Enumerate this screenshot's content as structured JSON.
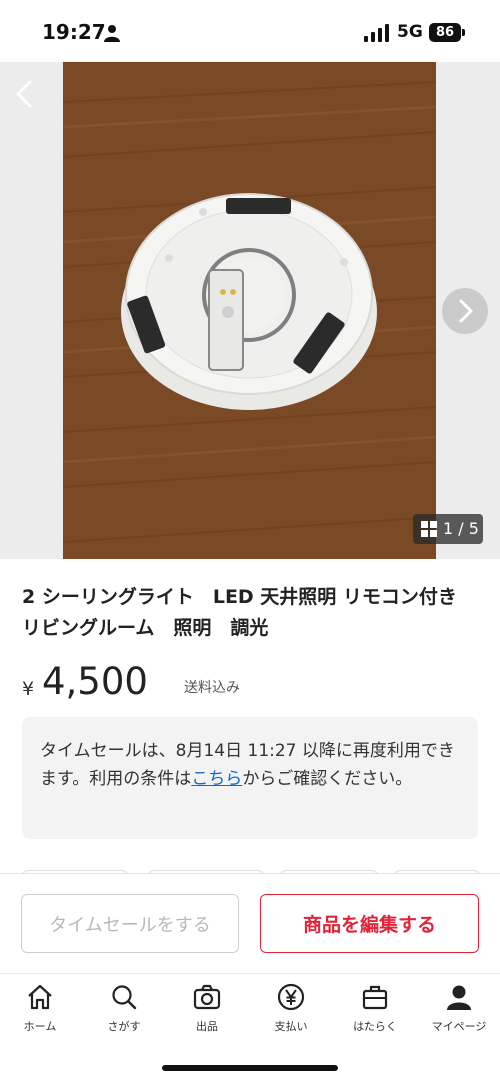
{
  "status_bar": {
    "time": "19:27",
    "network": "5G",
    "battery": "86"
  },
  "gallery": {
    "counter": "1 / 5"
  },
  "product": {
    "title": "2 シーリングライト　LED 天井照明 リモコン付き　リビングルーム　照明　調光",
    "currency": "¥",
    "price": "4,500",
    "shipping": "送料込み"
  },
  "notice": {
    "text_before": "タイムセールは、8月14日 11:27 以降に再度利用できます。利用の条件は",
    "link": "こちら",
    "text_after": "からご確認ください。"
  },
  "actions": {
    "timesale_label": "タイムセールをする",
    "edit_label": "商品を編集する",
    "edit_color": "#e0243a"
  },
  "tab_bar": {
    "items": [
      {
        "label": "ホーム",
        "icon": "home-icon"
      },
      {
        "label": "さがす",
        "icon": "search-icon"
      },
      {
        "label": "出品",
        "icon": "camera-icon"
      },
      {
        "label": "支払い",
        "icon": "yen-icon"
      },
      {
        "label": "はたらく",
        "icon": "briefcase-icon"
      },
      {
        "label": "マイページ",
        "icon": "person-icon"
      }
    ]
  }
}
